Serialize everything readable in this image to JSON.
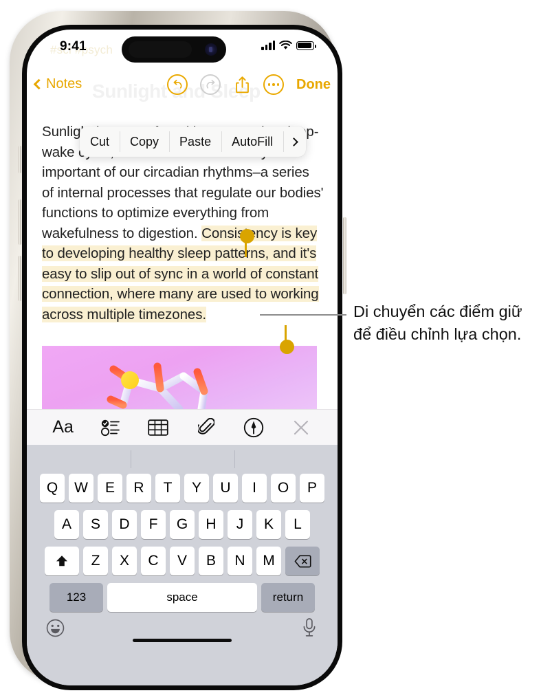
{
  "status_bar": {
    "time": "9:41",
    "signal_icon": "cellular-bars-icon",
    "wifi_icon": "wifi-icon",
    "battery_icon": "battery-full-icon"
  },
  "background_note": {
    "faded_tags": "#sci  #psych",
    "faded_title": "Sunlight and Sleep"
  },
  "navbar": {
    "back_label": "Notes",
    "back_icon": "chevron-left-icon",
    "undo_icon": "undo-arrow-icon",
    "redo_icon": "redo-arrow-icon",
    "share_icon": "share-up-arrow-icon",
    "more_icon": "ellipsis-circle-icon",
    "done_label": "Done"
  },
  "note": {
    "paragraph_before": "Sunlight has a profound impact on the sleep-wake cycle, one of the most crucially important of our circadian rhythms–a series of internal processes that regulate our bodies' functions to optimize everything from wakefulness to digestion. ",
    "highlighted": "Consistency is key to developing healthy sleep patterns, and it's easy to slip out of sync in a world of constant connection, where many are used to working across multiple timezones.",
    "image_alt": "molecule-illustration"
  },
  "context_menu": {
    "items": [
      "Cut",
      "Copy",
      "Paste",
      "AutoFill"
    ],
    "more_icon": "chevron-right-icon"
  },
  "selection": {
    "start_handle_name": "selection-start-handle",
    "end_handle_name": "selection-end-handle",
    "handle_color": "#d9a400"
  },
  "format_toolbar": {
    "buttons": [
      {
        "name": "text-format-icon",
        "label": "Aa"
      },
      {
        "name": "checklist-icon",
        "label": ""
      },
      {
        "name": "table-icon",
        "label": ""
      },
      {
        "name": "attachment-paperclip-icon",
        "label": ""
      },
      {
        "name": "markup-pen-icon",
        "label": ""
      },
      {
        "name": "close-x-icon",
        "label": ""
      }
    ]
  },
  "keyboard": {
    "row1": [
      "Q",
      "W",
      "E",
      "R",
      "T",
      "Y",
      "U",
      "I",
      "O",
      "P"
    ],
    "row2": [
      "A",
      "S",
      "D",
      "F",
      "G",
      "H",
      "J",
      "K",
      "L"
    ],
    "row3": [
      "Z",
      "X",
      "C",
      "V",
      "B",
      "N",
      "M"
    ],
    "shift_icon": "shift-up-arrow-icon",
    "backspace_icon": "delete-backward-icon",
    "numbers_label": "123",
    "space_label": "space",
    "return_label": "return",
    "emoji_icon": "emoji-smiley-icon",
    "dictation_icon": "microphone-icon"
  },
  "callout": {
    "text": "Di chuyển các điểm giữ để điều chỉnh lựa chọn."
  },
  "colors": {
    "accent": "#e8a700",
    "highlight": "#faf0d2",
    "handle": "#d9a400",
    "keyboard_bg": "#d0d2d9"
  }
}
